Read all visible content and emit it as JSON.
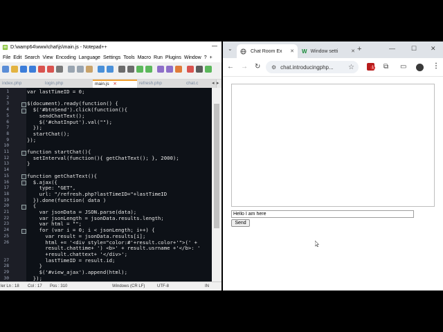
{
  "notepad": {
    "title": "D:\\wamp64\\www\\chat\\js\\main.js - Notepad++",
    "window_min": "—",
    "menu": [
      "File",
      "Edit",
      "Search",
      "View",
      "Encoding",
      "Language",
      "Settings",
      "Tools",
      "Macro",
      "Run",
      "Plugins",
      "Window",
      "?"
    ],
    "menu_more": "+",
    "tabs": [
      "index.php",
      "login.php",
      "main.js",
      "refresh.php",
      "chat.c"
    ],
    "active_tab": 2,
    "code_lines": [
      {
        "n": "1",
        "t": "var lastTimeID = 0;",
        "fold": false
      },
      {
        "n": "2",
        "t": "",
        "fold": false
      },
      {
        "n": "3",
        "t": "$(document).ready(function() {",
        "fold": true
      },
      {
        "n": "4",
        "t": "  $('#btnSend').click(function(){",
        "fold": true
      },
      {
        "n": "5",
        "t": "    sendChatText();",
        "fold": false
      },
      {
        "n": "6",
        "t": "    $('#chatInput').val(\"\");",
        "fold": false
      },
      {
        "n": "7",
        "t": "  });",
        "fold": false
      },
      {
        "n": "8",
        "t": "  startChat();",
        "fold": false
      },
      {
        "n": "9",
        "t": "});",
        "fold": false
      },
      {
        "n": "10",
        "t": "",
        "fold": false
      },
      {
        "n": "11",
        "t": "function startChat(){",
        "fold": true
      },
      {
        "n": "12",
        "t": "  setInterval(function(){ getChatText(); }, 2000);",
        "fold": false
      },
      {
        "n": "13",
        "t": "}",
        "fold": false
      },
      {
        "n": "14",
        "t": "",
        "fold": false
      },
      {
        "n": "15",
        "t": "function getChatText(){",
        "fold": true
      },
      {
        "n": "16",
        "t": "  $.ajax({",
        "fold": true
      },
      {
        "n": "17",
        "t": "    type: \"GET\",",
        "fold": false
      },
      {
        "n": "18",
        "t": "    url: \"/refresh.php?lastTimeID=\"+lastTimeID",
        "fold": false
      },
      {
        "n": "19",
        "t": "  }).done(function( data )",
        "fold": false
      },
      {
        "n": "20",
        "t": "  {",
        "fold": true
      },
      {
        "n": "21",
        "t": "    var jsonData = JSON.parse(data);",
        "fold": false
      },
      {
        "n": "22",
        "t": "    var jsonLength = jsonData.results.length;",
        "fold": false
      },
      {
        "n": "23",
        "t": "    var html = \"\";",
        "fold": false
      },
      {
        "n": "24",
        "t": "    for (var i = 0; i < jsonLength; i++) {",
        "fold": true
      },
      {
        "n": "25",
        "t": "      var result = jsonData.results[i];",
        "fold": false
      },
      {
        "n": "26",
        "t": "      html += '<div style=\"color:#'+result.color+'\">(' +",
        "fold": false
      },
      {
        "n": "",
        "t": "      result.chattime+ ') <b>' + result.usrname +'</b>: '",
        "fold": false
      },
      {
        "n": "",
        "t": "      +result.chattext+ '</div>';",
        "fold": false
      },
      {
        "n": "27",
        "t": "      lastTimeID = result.id;",
        "fold": false
      },
      {
        "n": "28",
        "t": "    }",
        "fold": false
      },
      {
        "n": "29",
        "t": "    $('#view_ajax').append(html);",
        "fold": false
      },
      {
        "n": "30",
        "t": "  });",
        "fold": false
      }
    ],
    "status": {
      "ln": "ler Ln : 18",
      "col": "Col : 17",
      "pos": "Pos : 310",
      "eol": "Windows (CR LF)",
      "enc": "UTF-8",
      "mode": "IN"
    }
  },
  "chrome": {
    "tabs": [
      {
        "title": "Chat Room Ex",
        "icon": "globe-icon"
      },
      {
        "title": "Window setti",
        "icon": "w-logo-icon"
      }
    ],
    "new_tab": "+",
    "window_controls": {
      "minimize": "—",
      "maximize": "☐",
      "close": "✕"
    },
    "omnibox_url": "chat.introducingphp...",
    "icons": [
      "back-icon",
      "forward-icon",
      "reload-icon",
      "site-info-icon",
      "star-icon",
      "extension-icon",
      "puzzle-icon",
      "sidebar-icon",
      "profile-icon",
      "menu-icon"
    ],
    "extension_badge": "1"
  },
  "chat_page": {
    "input_value": "Hello I am here",
    "send_label": "Send"
  }
}
